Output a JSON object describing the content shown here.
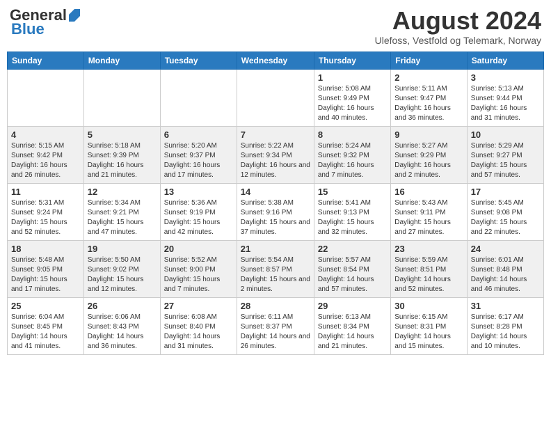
{
  "logo": {
    "general": "General",
    "blue": "Blue"
  },
  "title": "August 2024",
  "location": "Ulefoss, Vestfold og Telemark, Norway",
  "weekdays": [
    "Sunday",
    "Monday",
    "Tuesday",
    "Wednesday",
    "Thursday",
    "Friday",
    "Saturday"
  ],
  "weeks": [
    [
      {
        "day": "",
        "info": ""
      },
      {
        "day": "",
        "info": ""
      },
      {
        "day": "",
        "info": ""
      },
      {
        "day": "",
        "info": ""
      },
      {
        "day": "1",
        "info": "Sunrise: 5:08 AM\nSunset: 9:49 PM\nDaylight: 16 hours and 40 minutes."
      },
      {
        "day": "2",
        "info": "Sunrise: 5:11 AM\nSunset: 9:47 PM\nDaylight: 16 hours and 36 minutes."
      },
      {
        "day": "3",
        "info": "Sunrise: 5:13 AM\nSunset: 9:44 PM\nDaylight: 16 hours and 31 minutes."
      }
    ],
    [
      {
        "day": "4",
        "info": "Sunrise: 5:15 AM\nSunset: 9:42 PM\nDaylight: 16 hours and 26 minutes."
      },
      {
        "day": "5",
        "info": "Sunrise: 5:18 AM\nSunset: 9:39 PM\nDaylight: 16 hours and 21 minutes."
      },
      {
        "day": "6",
        "info": "Sunrise: 5:20 AM\nSunset: 9:37 PM\nDaylight: 16 hours and 17 minutes."
      },
      {
        "day": "7",
        "info": "Sunrise: 5:22 AM\nSunset: 9:34 PM\nDaylight: 16 hours and 12 minutes."
      },
      {
        "day": "8",
        "info": "Sunrise: 5:24 AM\nSunset: 9:32 PM\nDaylight: 16 hours and 7 minutes."
      },
      {
        "day": "9",
        "info": "Sunrise: 5:27 AM\nSunset: 9:29 PM\nDaylight: 16 hours and 2 minutes."
      },
      {
        "day": "10",
        "info": "Sunrise: 5:29 AM\nSunset: 9:27 PM\nDaylight: 15 hours and 57 minutes."
      }
    ],
    [
      {
        "day": "11",
        "info": "Sunrise: 5:31 AM\nSunset: 9:24 PM\nDaylight: 15 hours and 52 minutes."
      },
      {
        "day": "12",
        "info": "Sunrise: 5:34 AM\nSunset: 9:21 PM\nDaylight: 15 hours and 47 minutes."
      },
      {
        "day": "13",
        "info": "Sunrise: 5:36 AM\nSunset: 9:19 PM\nDaylight: 15 hours and 42 minutes."
      },
      {
        "day": "14",
        "info": "Sunrise: 5:38 AM\nSunset: 9:16 PM\nDaylight: 15 hours and 37 minutes."
      },
      {
        "day": "15",
        "info": "Sunrise: 5:41 AM\nSunset: 9:13 PM\nDaylight: 15 hours and 32 minutes."
      },
      {
        "day": "16",
        "info": "Sunrise: 5:43 AM\nSunset: 9:11 PM\nDaylight: 15 hours and 27 minutes."
      },
      {
        "day": "17",
        "info": "Sunrise: 5:45 AM\nSunset: 9:08 PM\nDaylight: 15 hours and 22 minutes."
      }
    ],
    [
      {
        "day": "18",
        "info": "Sunrise: 5:48 AM\nSunset: 9:05 PM\nDaylight: 15 hours and 17 minutes."
      },
      {
        "day": "19",
        "info": "Sunrise: 5:50 AM\nSunset: 9:02 PM\nDaylight: 15 hours and 12 minutes."
      },
      {
        "day": "20",
        "info": "Sunrise: 5:52 AM\nSunset: 9:00 PM\nDaylight: 15 hours and 7 minutes."
      },
      {
        "day": "21",
        "info": "Sunrise: 5:54 AM\nSunset: 8:57 PM\nDaylight: 15 hours and 2 minutes."
      },
      {
        "day": "22",
        "info": "Sunrise: 5:57 AM\nSunset: 8:54 PM\nDaylight: 14 hours and 57 minutes."
      },
      {
        "day": "23",
        "info": "Sunrise: 5:59 AM\nSunset: 8:51 PM\nDaylight: 14 hours and 52 minutes."
      },
      {
        "day": "24",
        "info": "Sunrise: 6:01 AM\nSunset: 8:48 PM\nDaylight: 14 hours and 46 minutes."
      }
    ],
    [
      {
        "day": "25",
        "info": "Sunrise: 6:04 AM\nSunset: 8:45 PM\nDaylight: 14 hours and 41 minutes."
      },
      {
        "day": "26",
        "info": "Sunrise: 6:06 AM\nSunset: 8:43 PM\nDaylight: 14 hours and 36 minutes."
      },
      {
        "day": "27",
        "info": "Sunrise: 6:08 AM\nSunset: 8:40 PM\nDaylight: 14 hours and 31 minutes."
      },
      {
        "day": "28",
        "info": "Sunrise: 6:11 AM\nSunset: 8:37 PM\nDaylight: 14 hours and 26 minutes."
      },
      {
        "day": "29",
        "info": "Sunrise: 6:13 AM\nSunset: 8:34 PM\nDaylight: 14 hours and 21 minutes."
      },
      {
        "day": "30",
        "info": "Sunrise: 6:15 AM\nSunset: 8:31 PM\nDaylight: 14 hours and 15 minutes."
      },
      {
        "day": "31",
        "info": "Sunrise: 6:17 AM\nSunset: 8:28 PM\nDaylight: 14 hours and 10 minutes."
      }
    ]
  ]
}
